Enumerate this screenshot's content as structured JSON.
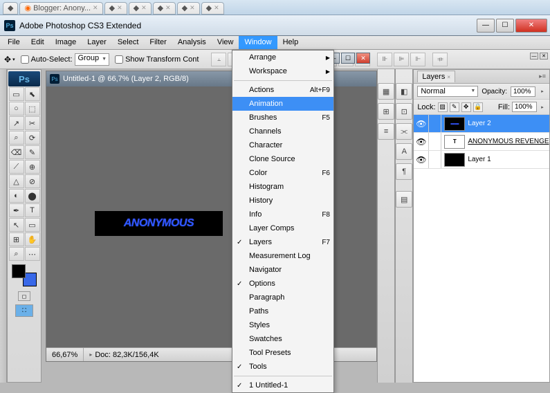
{
  "browser_tabs": [
    "",
    "Blogger: Anony...",
    "",
    "",
    "",
    "",
    ""
  ],
  "titlebar": {
    "app_name": "Ps",
    "title": "Adobe Photoshop CS3 Extended"
  },
  "win_controls": {
    "min": "—",
    "max": "☐",
    "close": "✕"
  },
  "menubar": [
    "File",
    "Edit",
    "Image",
    "Layer",
    "Select",
    "Filter",
    "Analysis",
    "View",
    "Window",
    "Help"
  ],
  "menubar_open_index": 8,
  "optionsbar": {
    "auto_select": "Auto-Select:",
    "group": "Group",
    "show_transform": "Show Transform Cont"
  },
  "toolbox_header": "Ps",
  "tools": [
    "▭",
    "⬉",
    "○",
    "⬚",
    "↗",
    "✂",
    "⌕",
    "⟳",
    "⌫",
    "✎",
    "⟋",
    "⊕",
    "△",
    "⊘",
    "◐",
    "⬤",
    "✒",
    "T",
    "↖",
    "▭",
    "⊞",
    "✋",
    "⌕",
    "⋯"
  ],
  "doc": {
    "title": "Untitled-1 @ 66,7% (Layer 2, RGB/8)",
    "canvas_text": "ANONYMOUS",
    "zoom": "66,67%",
    "info": "Doc: 82,3K/156,4K"
  },
  "window_menu": {
    "top": [
      {
        "label": "Arrange",
        "arrow": true
      },
      {
        "label": "Workspace",
        "arrow": true
      }
    ],
    "main": [
      {
        "label": "Actions",
        "shortcut": "Alt+F9"
      },
      {
        "label": "Animation",
        "highlighted": true
      },
      {
        "label": "Brushes",
        "shortcut": "F5"
      },
      {
        "label": "Channels"
      },
      {
        "label": "Character"
      },
      {
        "label": "Clone Source"
      },
      {
        "label": "Color",
        "shortcut": "F6"
      },
      {
        "label": "Histogram"
      },
      {
        "label": "History"
      },
      {
        "label": "Info",
        "shortcut": "F8"
      },
      {
        "label": "Layer Comps"
      },
      {
        "label": "Layers",
        "shortcut": "F7",
        "checked": true
      },
      {
        "label": "Measurement Log"
      },
      {
        "label": "Navigator"
      },
      {
        "label": "Options",
        "checked": true
      },
      {
        "label": "Paragraph"
      },
      {
        "label": "Paths"
      },
      {
        "label": "Styles"
      },
      {
        "label": "Swatches"
      },
      {
        "label": "Tool Presets"
      },
      {
        "label": "Tools",
        "checked": true
      }
    ],
    "bottom": [
      {
        "label": "1 Untitled-1",
        "checked": true
      }
    ]
  },
  "dock_icons_col1": [
    "▦",
    "⊞",
    "≡"
  ],
  "dock_icons_col2": [
    "◧",
    "⊡",
    "⫘",
    "A",
    "¶",
    "",
    "▤"
  ],
  "layers_panel": {
    "tab": "Layers",
    "blend_mode": "Normal",
    "opacity_label": "Opacity:",
    "opacity": "100%",
    "lock_label": "Lock:",
    "fill_label": "Fill:",
    "fill": "100%",
    "layers": [
      {
        "name": "Layer 2",
        "type": "graphic",
        "selected": true
      },
      {
        "name": "ANONYMOUS REVENGE",
        "type": "text",
        "underline": true
      },
      {
        "name": "Layer 1",
        "type": "solid"
      }
    ]
  }
}
